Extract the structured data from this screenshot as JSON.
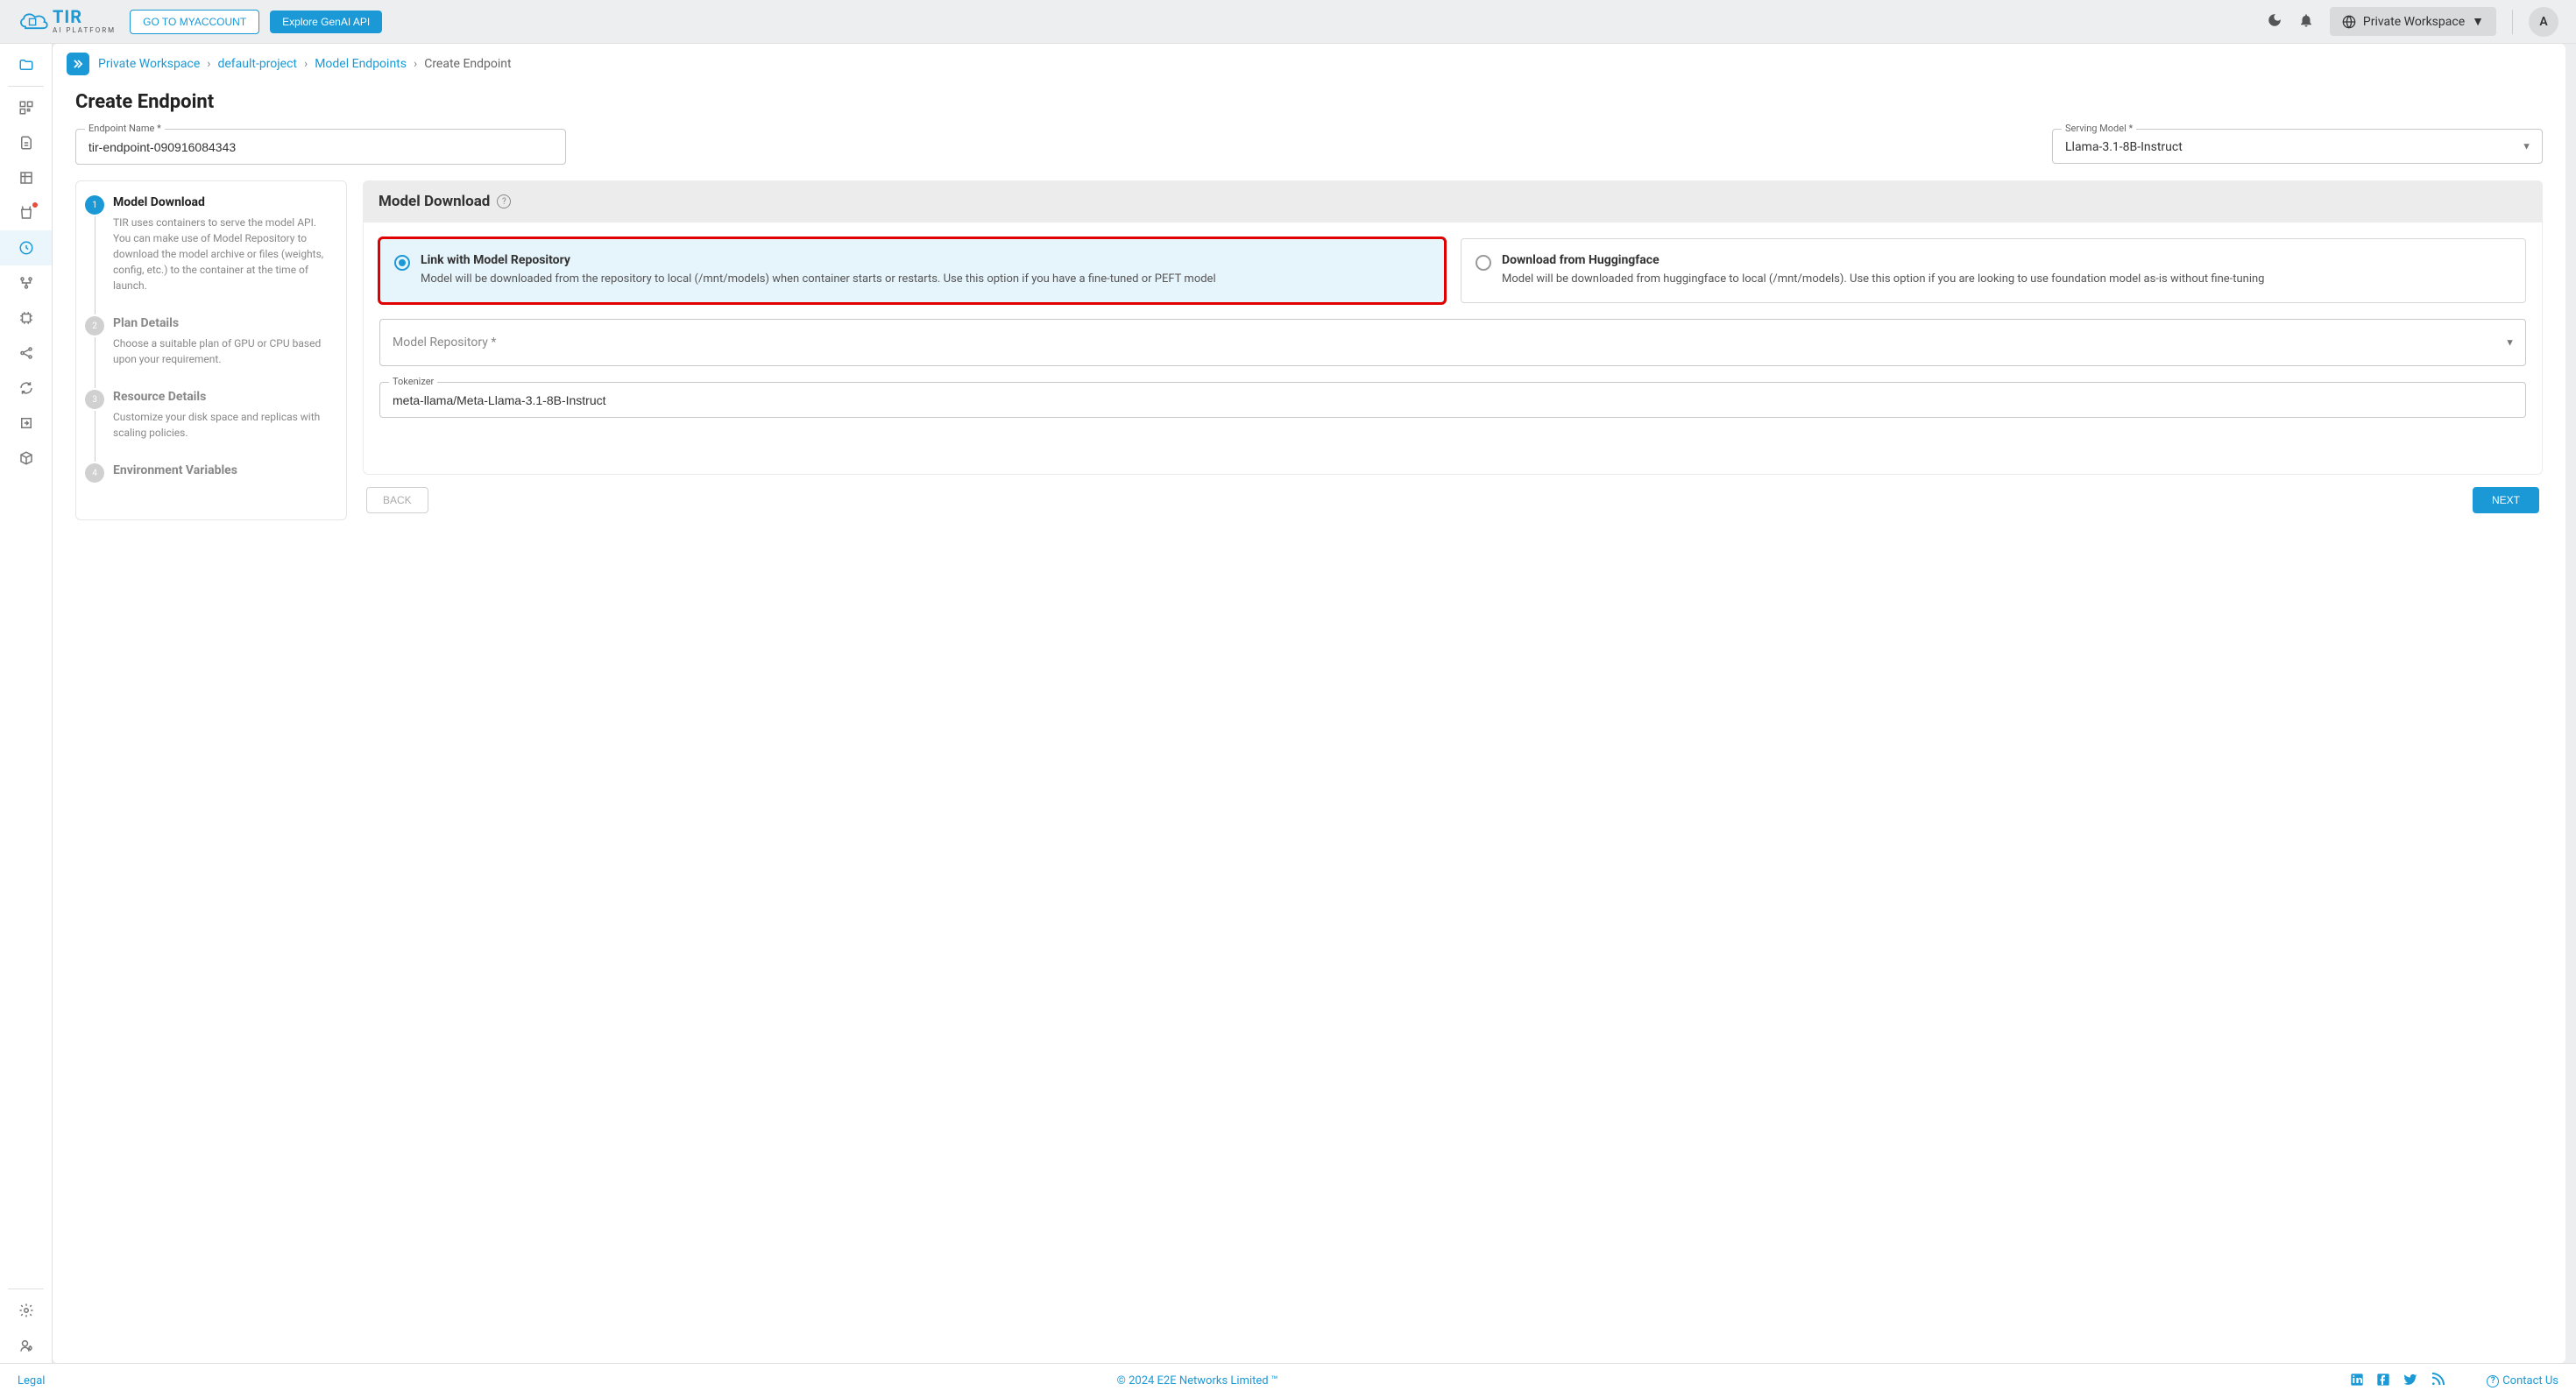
{
  "logo": {
    "text": "TIR",
    "subtitle": "AI PLATFORM"
  },
  "header": {
    "myaccount_btn": "GO TO MYACCOUNT",
    "genai_btn": "Explore GenAI API",
    "workspace": "Private Workspace",
    "avatar_initial": "A"
  },
  "breadcrumb": {
    "items": [
      "Private Workspace",
      "default-project",
      "Model Endpoints"
    ],
    "current": "Create Endpoint"
  },
  "page_title": "Create Endpoint",
  "form": {
    "endpoint_name_label": "Endpoint Name *",
    "endpoint_name_value": "tir-endpoint-090916084343",
    "serving_model_label": "Serving Model *",
    "serving_model_value": "Llama-3.1-8B-Instruct"
  },
  "stepper": [
    {
      "title": "Model Download",
      "desc": "TIR uses containers to serve the model API. You can make use of Model Repository to download the model archive or files (weights, config, etc.) to the container at the time of launch."
    },
    {
      "title": "Plan Details",
      "desc": "Choose a suitable plan of GPU or CPU based upon your requirement."
    },
    {
      "title": "Resource Details",
      "desc": "Customize your disk space and replicas with scaling policies."
    },
    {
      "title": "Environment Variables",
      "desc": ""
    }
  ],
  "panel": {
    "header": "Model Download",
    "options": [
      {
        "title": "Link with Model Repository",
        "desc": "Model will be downloaded from the repository to local (/mnt/models) when container starts or restarts. Use this option if you have a fine-tuned or PEFT model"
      },
      {
        "title": "Download from Huggingface",
        "desc": "Model will be downloaded from huggingface to local (/mnt/models). Use this option if you are looking to use foundation model as-is without fine-tuning"
      }
    ],
    "model_repo_label": "Model Repository *",
    "tokenizer_label": "Tokenizer",
    "tokenizer_value": "meta-llama/Meta-Llama-3.1-8B-Instruct",
    "back_btn": "BACK",
    "next_btn": "NEXT"
  },
  "footer": {
    "legal": "Legal",
    "copyright": "© 2024 E2E Networks Limited ™",
    "contact": "Contact Us"
  }
}
